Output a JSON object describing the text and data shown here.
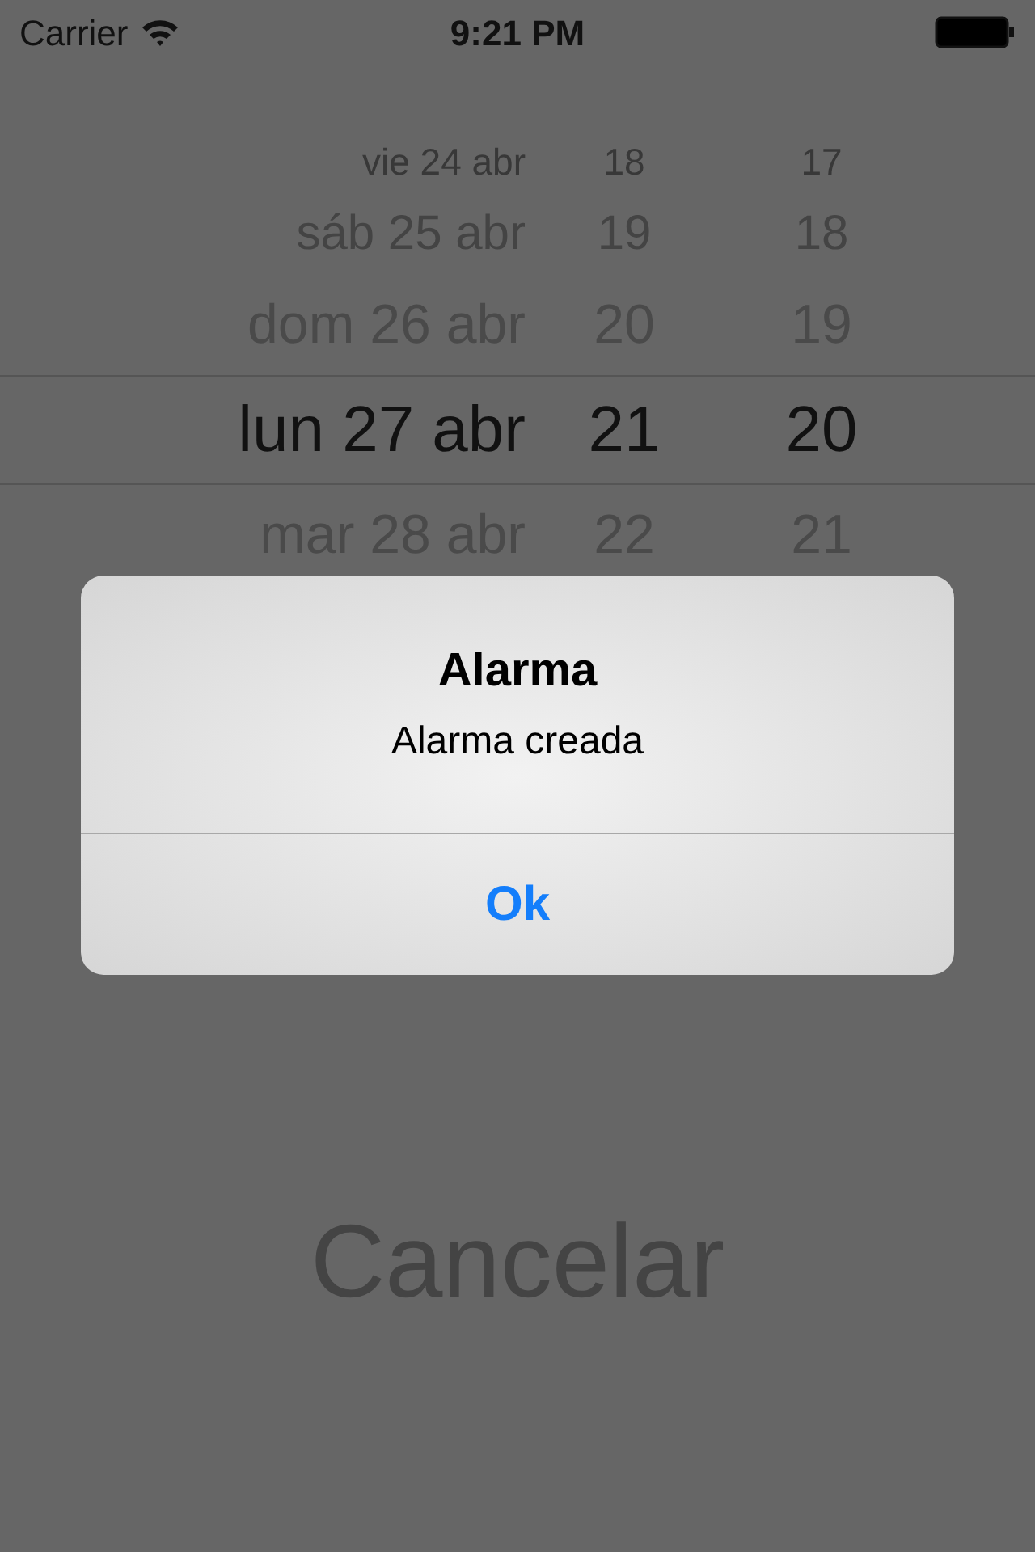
{
  "status_bar": {
    "carrier": "Carrier",
    "time": "9:21 PM"
  },
  "picker": {
    "rows": [
      {
        "date": "vie 24 abr",
        "hour": "18",
        "minute": "17",
        "selected": false
      },
      {
        "date": "sáb 25 abr",
        "hour": "19",
        "minute": "18",
        "selected": false
      },
      {
        "date": "dom 26 abr",
        "hour": "20",
        "minute": "19",
        "selected": false
      },
      {
        "date": "lun 27 abr",
        "hour": "21",
        "minute": "20",
        "selected": true
      },
      {
        "date": "mar 28 abr",
        "hour": "22",
        "minute": "21",
        "selected": false
      }
    ]
  },
  "buttons": [
    "Cancelar"
  ],
  "alert": {
    "title": "Alarma",
    "message": "Alarma creada",
    "button": "Ok"
  }
}
